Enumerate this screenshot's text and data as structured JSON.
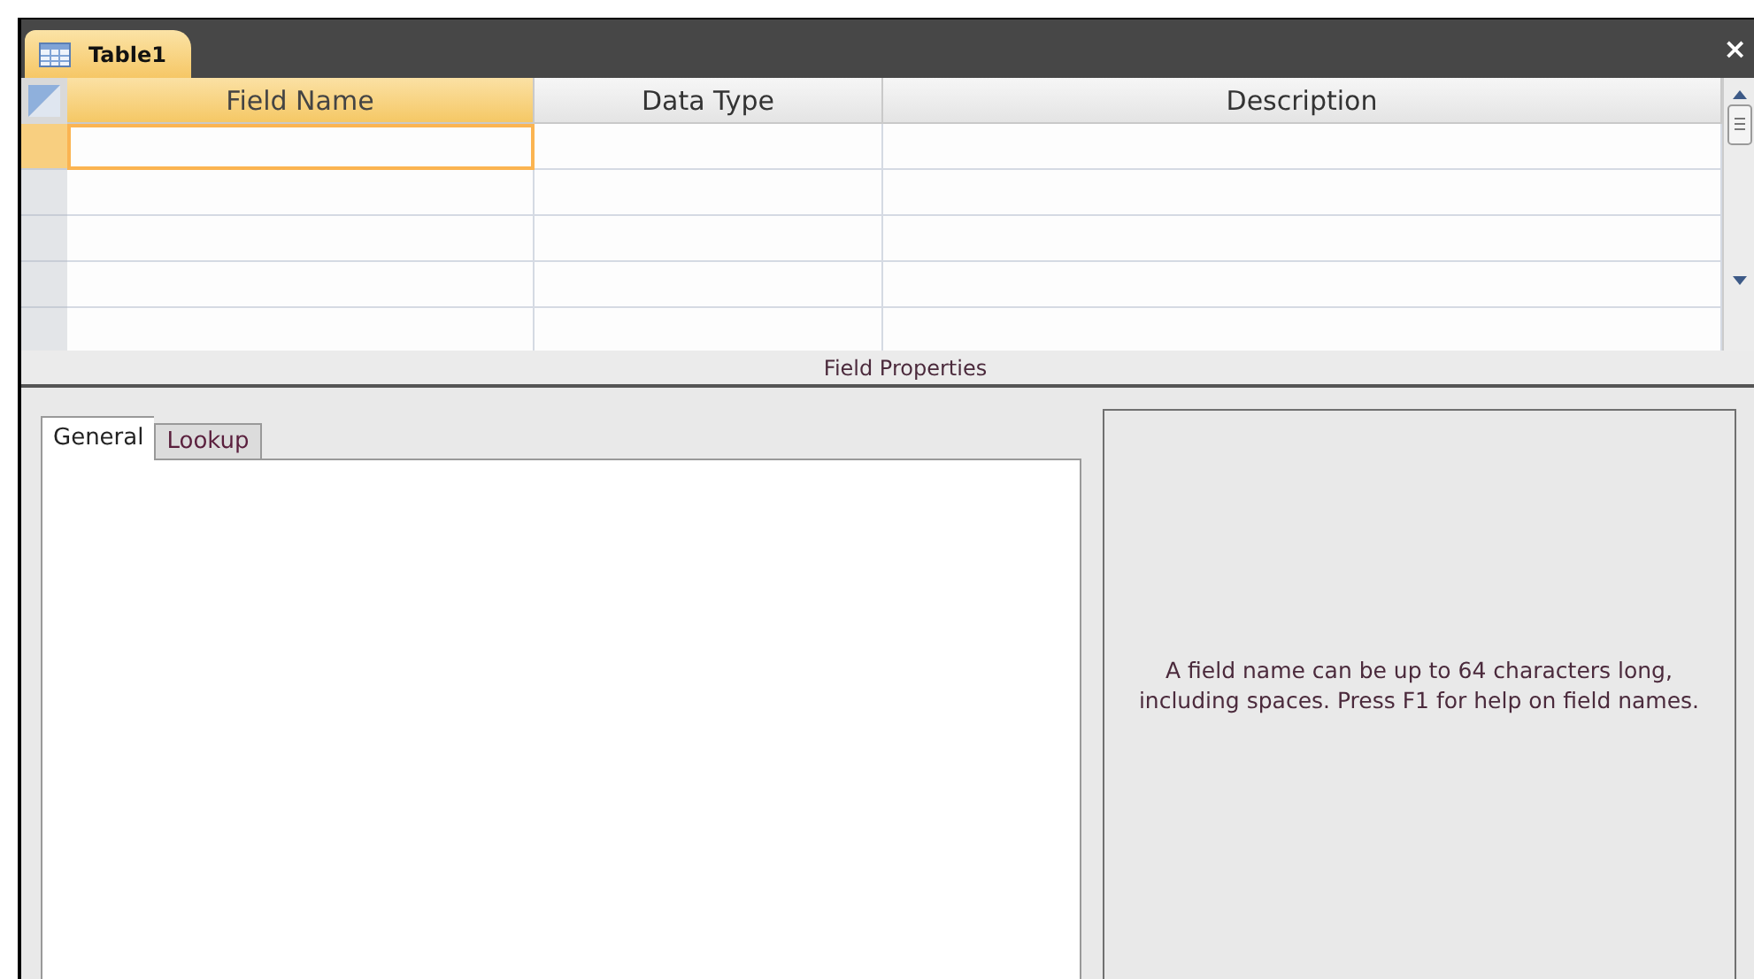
{
  "document_tab": {
    "title": "Table1",
    "close": "×"
  },
  "table": {
    "columns": [
      "Field Name",
      "Data Type",
      "Description"
    ],
    "rows": [
      {
        "selected": true
      },
      {
        "selected": false
      },
      {
        "selected": false
      },
      {
        "selected": false
      },
      {
        "selected": false
      }
    ]
  },
  "field_properties": {
    "title": "Field Properties",
    "tabs": [
      {
        "label": "General",
        "selected": true
      },
      {
        "label": "Lookup",
        "selected": false
      }
    ],
    "help_text": "A field name can be up to 64 characters long, including spaces.  Press F1 for help on field names."
  }
}
